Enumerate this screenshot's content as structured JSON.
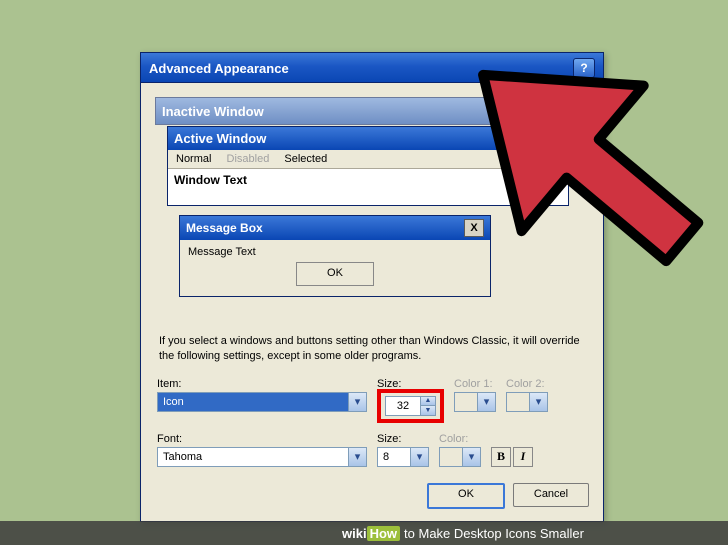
{
  "dialog": {
    "title": "Advanced Appearance",
    "help": "?"
  },
  "preview": {
    "inactive_title": "Inactive Window",
    "active_title": "Active Window",
    "menu_normal": "Normal",
    "menu_disabled": "Disabled",
    "menu_selected": "Selected",
    "window_text": "Window Text",
    "msgbox_title": "Message Box",
    "msgbox_text": "Message Text",
    "msgbox_ok": "OK",
    "close_x": "X"
  },
  "description": "If you select a windows and buttons setting other than Windows Classic, it will override the following settings, except in some older programs.",
  "labels": {
    "item": "Item:",
    "size": "Size:",
    "color1": "Color 1:",
    "color2": "Color 2:",
    "font": "Font:",
    "color": "Color:"
  },
  "values": {
    "item": "Icon",
    "item_size": "32",
    "font": "Tahoma",
    "font_size": "8",
    "bold": "B",
    "italic": "I",
    "chevron": "▾",
    "up": "▲",
    "down": "▼"
  },
  "buttons": {
    "ok": "OK",
    "cancel": "Cancel"
  },
  "caption": {
    "wiki": "wiki",
    "how": "How",
    "text": " to Make Desktop Icons Smaller"
  }
}
